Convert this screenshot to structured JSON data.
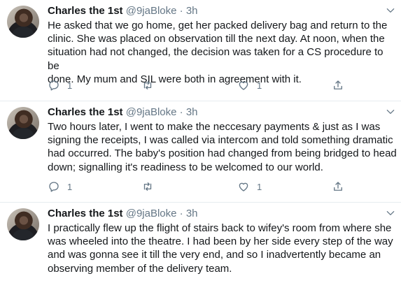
{
  "tweets": [
    {
      "author": "Charles the 1st",
      "handle": "@9jaBloke",
      "separator": "·",
      "time": "3h",
      "text": "He asked that we go home, get her packed delivery bag and return to the\nclinic. She was placed on observation till the next day. At noon, when the\nsituation had not changed, the decision was taken for a CS procedure to be\ndone. My mum and SIL were both in agreement with it.",
      "reply_count": "1",
      "retweet_count": "",
      "like_count": "1"
    },
    {
      "author": "Charles the 1st",
      "handle": "@9jaBloke",
      "separator": "·",
      "time": "3h",
      "text": "Two hours later, I went to make the neccesary payments & just as I was\nsigning the receipts, I was called via intercom and told something dramatic\nhad occurred. The baby's position had changed from being bridged to head\ndown; signalling it's readiness to be welcomed to our world.",
      "reply_count": "1",
      "retweet_count": "",
      "like_count": "1"
    },
    {
      "author": "Charles the 1st",
      "handle": "@9jaBloke",
      "separator": "·",
      "time": "3h",
      "text": "I practically flew up the flight of stairs back to wifey's room from where she\nwas wheeled into the theatre. I had been by her side every step of the way\nand was gonna see it till the very end, and so I inadvertently became an\nobserving member of the delivery team.",
      "reply_count": "",
      "retweet_count": "",
      "like_count": ""
    }
  ],
  "icons": {
    "reply": "reply-icon",
    "retweet": "retweet-icon",
    "like": "like-icon",
    "share": "share-icon",
    "caret": "chevron-down-icon"
  },
  "colors": {
    "text": "#14171a",
    "secondary": "#657786",
    "divider": "#e6ecf0"
  }
}
